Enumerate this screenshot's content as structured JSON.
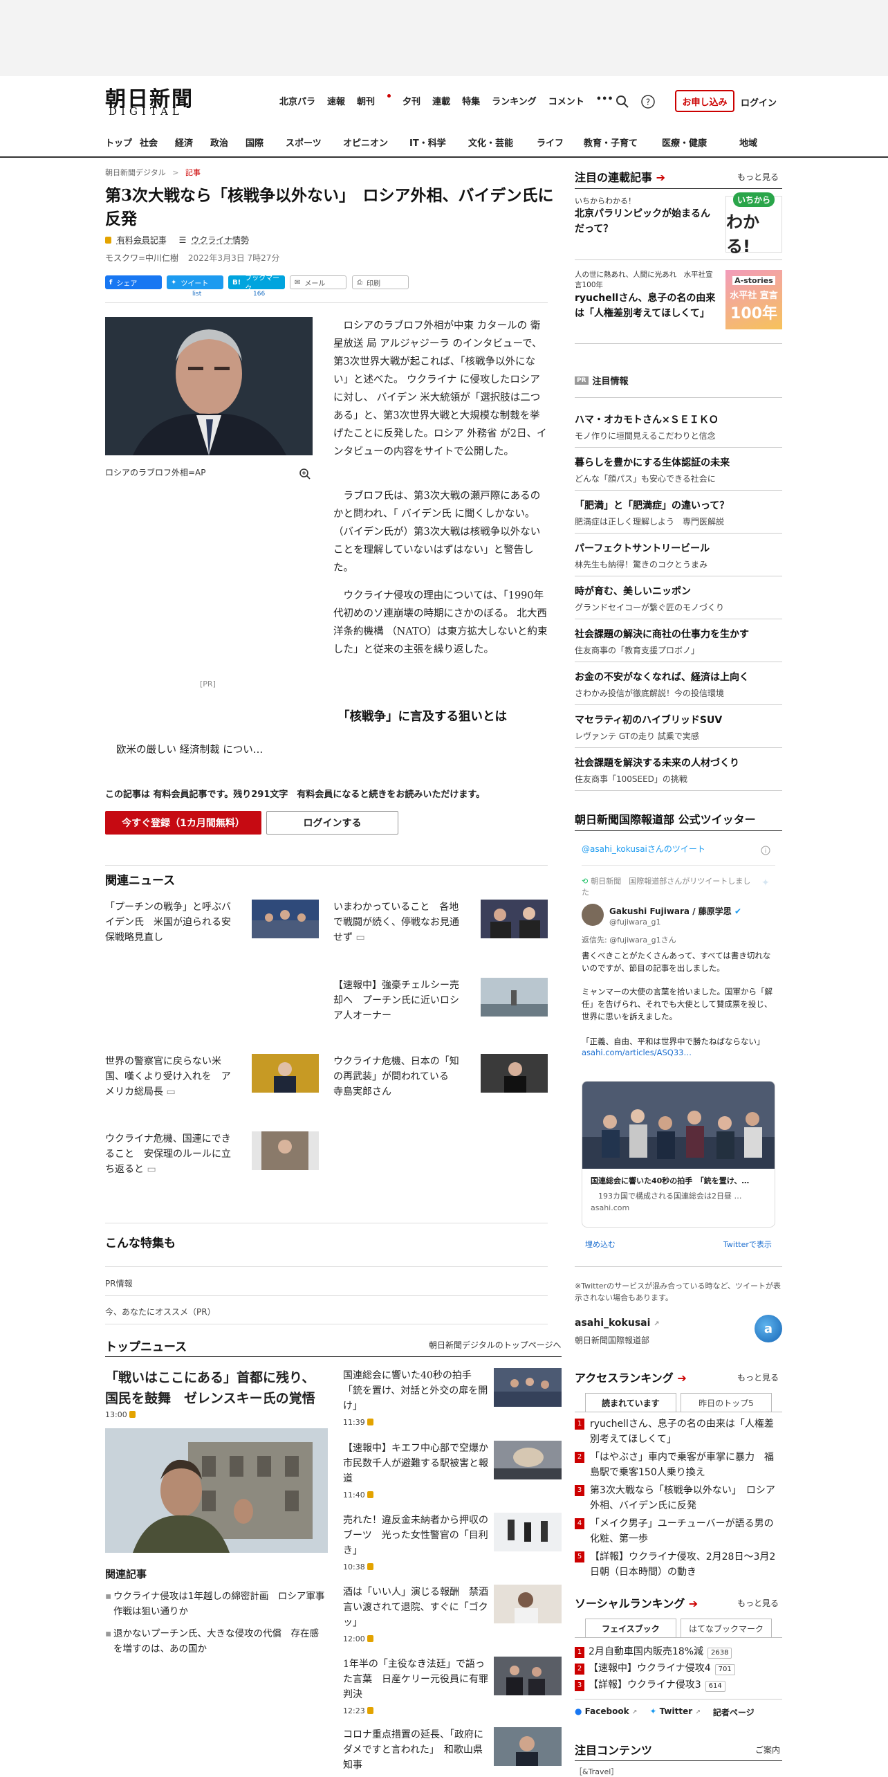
{
  "header": {
    "logo_text": "朝日新聞",
    "logo_sub": "DIGITAL",
    "top_nav": [
      "北京パラ",
      "速報",
      "朝刊",
      "夕刊",
      "連載",
      "特集",
      "ランキング",
      "コメント"
    ],
    "more": "•••",
    "subscribe": "お申し込み",
    "login": "ログイン"
  },
  "main_nav": [
    "トップ",
    "社会",
    "経済",
    "政治",
    "国際",
    "スポーツ",
    "オピニオン",
    "IT・科学",
    "文化・芸能",
    "ライフ",
    "教育・子育て",
    "医療・健康",
    "地域"
  ],
  "breadcrumb": {
    "home": "朝日新聞デジタル",
    "sep": ">",
    "current": "記事"
  },
  "article": {
    "title": "第3次大戦なら「核戦争以外ない」　ロシア外相、バイデン氏に反発",
    "member_tag": "有料会員記事",
    "topic": "ウクライナ情勢",
    "byline": "モスクワ=中川仁樹",
    "date": "2022年3月3日 7時27分",
    "share": {
      "facebook": "シェア",
      "twitter": "ツイート",
      "twitter_count": "list",
      "hatena": "ブックマーク",
      "hatena_count": "166",
      "mail": "メール",
      "print": "印刷"
    },
    "photo_caption": "ロシアのラブロフ外相=AP",
    "paragraphs": [
      "ロシアのラブロフ外相が中東 カタールの 衛星放送 局 アルジャジーラ のインタビューで、第3次世界大戦が起これば、「核戦争以外にない」と述べた。 ウクライナ に侵攻したロシアに対し、 バイデン 米大統領が「選択肢は二つある」と、第3次世界大戦と大規模な制裁を挙げたことに反発した。ロシア 外務省 が2日、インタビューの内容をサイトで公開した。",
      "ラブロフ氏は、第3次大戦の瀬戸際にあるのかと問われ、「 バイデン氏 に聞くしかない。（バイデン氏が）第3次大戦は核戦争以外ないことを理解していないはずはない」と警告した。",
      "ウクライナ侵攻の理由については、「1990年代初めのソ連崩壊の時期にさかのぼる。 北大西洋条約機構 （NATO）は東方拡大しないと約束した」と従来の主張を繰り返した。"
    ],
    "pr": "[PR]",
    "subhead": "「核戦争」に言及する狙いとは",
    "teaser": "欧米の厳しい 経済制裁 につい…",
    "paywall": "この記事は 有料会員記事です。残り291文字　有料会員になると続きをお読みいただけます。",
    "register_btn": "今すぐ登録（1カ月間無料）",
    "login_btn": "ログインする"
  },
  "related": {
    "heading": "関連ニュース",
    "items": [
      "「プーチンの戦争」と呼ぶバイデン氏　米国が迫られる安保戦略見直し",
      "いまわかっていること　各地で戦闘が続く、停戦なお見通せず",
      "【速報中】強豪チェルシー売却へ　プーチン氏に近いロシア人オーナー",
      "世界の警察官に戻らない米国、嘆くより受け入れを　アメリカ総局長",
      "ウクライナ危機、日本の「知の再武装」が問われている　寺島実郎さん",
      "ウクライナ危機、国連にできること　安保理のルールに立ち返ると"
    ]
  },
  "tokushu": {
    "heading": "こんな特集も",
    "pr_info": "PR情報",
    "recommend": "今、あなたにオススメ（PR）"
  },
  "top_news": {
    "heading": "トップニュース",
    "link": "朝日新聞デジタルのトップページへ",
    "lead_title": "「戦いはここにある」首都に残り、国民を鼓舞　ゼレンスキー氏の覚悟",
    "lead_time": "13:00",
    "related_heading": "関連記事",
    "related_items": [
      "ウクライナ侵攻は1年越しの綿密計画　ロシア軍事作戦は狙い通りか",
      "退かないプーチン氏、大きな侵攻の代償　存在感を増すのは、あの国か"
    ],
    "items": [
      {
        "title": "国連総会に響いた40秒の拍手「銃を置け、対話と外交の扉を開け」",
        "time": "11:39"
      },
      {
        "title": "【速報中】キエフ中心部で空爆か　市民数千人が避難する駅被害と報道",
        "time": "11:40"
      },
      {
        "title": "売れた！違反金未納者から押収のブーツ　光った女性警官の「目利き」",
        "time": "10:38"
      },
      {
        "title": "酒は「いい人」演じる報酬　禁酒言い渡されて退院、すぐに「ゴクッ」",
        "time": "12:00"
      },
      {
        "title": "1年半の「主役なき法廷」で語った言葉　日産ケリー元役員に有罪判決",
        "time": "12:23"
      },
      {
        "title": "コロナ重点措置の延長、「政府にダメですと言われた」　和歌山県知事",
        "time": ""
      }
    ]
  },
  "sidebar": {
    "serial_heading": "注目の連載記事",
    "more": "もっと見る",
    "serials": [
      {
        "label": "いちからわかる！",
        "title": "北京パラリンピックが始まるんだって？",
        "badge": "いちから わかる!"
      },
      {
        "label": "人の世に熱あれ、人間に光あれ　水平社宣言100年",
        "title": "ryuchellさん、息子の名の由来は「人権差別考えてほしくて」",
        "badge": "水平社 宣言 100年"
      }
    ],
    "attention_heading": "注目情報",
    "attention": [
      {
        "title": "ハマ・オカモトさん×ＳＥＩＫＯ",
        "sub": "モノ作りに垣間見えるこだわりと信念"
      },
      {
        "title": "暮らしを豊かにする生体認証の未来",
        "sub": "どんな「顔パス」も安心できる社会に"
      },
      {
        "title": "「肥満」と「肥満症」の違いって？",
        "sub": "肥満症は正しく理解しよう　専門医解説"
      },
      {
        "title": "パーフェクトサントリービール",
        "sub": "林先生も納得！驚きのコクとうまみ"
      },
      {
        "title": "時が育む、美しいニッポン",
        "sub": "グランドセイコーが繋ぐ匠のモノづくり"
      },
      {
        "title": "社会課題の解決に商社の仕事力を生かす",
        "sub": "住友商事の「教育支援プロボノ」"
      },
      {
        "title": "お金の不安がなくなれば、経済は上向く",
        "sub": "さわかみ投信が徹底解説！今の投信環境"
      },
      {
        "title": "マセラティ初のハイブリッドSUV",
        "sub": "レヴァンテ GTの走り 試乗で実感"
      },
      {
        "title": "社会課題を解決する未来の人材づくり",
        "sub": "住友商事「100SEED」の挑戦"
      }
    ],
    "twitter_heading": "朝日新聞国際報道部 公式ツイッター",
    "twitter": {
      "handle_line": "@asahi_kokusaiさんのツイート",
      "rt_line": "朝日新聞　国際報道部さんがリツイートしました",
      "user_name": "Gakushi Fujiwara / 藤原学思",
      "user_handle": "@fujiwara_g1",
      "reply_to": "返信先: @fujiwara_g1さん",
      "text1": "書くべきことがたくさんあって、すべては書き切れないのですが、節目の記事を出しました。",
      "text2": "ミャンマーの大使の言葉を拾いました。国軍から「解任」を告げられ、それでも大使として賛成票を投じ、世界に思いを訴えました。",
      "text3": "「正義、自由、平和は世界中で勝たねばならない」",
      "link": "asahi.com/articles/ASQ33…",
      "card_title": "国連総会に響いた40秒の拍手　「銃を置け、…",
      "card_desc": "　193カ国で構成される国連総会は2日昼 …",
      "card_domain": "asahi.com",
      "embed": "埋め込む",
      "view": "Twitterで表示",
      "notice": "※Twitterのサービスが混み合っている時など、ツイートが表示されない場合もあります。",
      "account": "asahi_kokusai",
      "account_name": "朝日新聞国際報道部"
    },
    "access_heading": "アクセスランキング",
    "access_tabs": [
      "読まれています",
      "昨日のトップ5"
    ],
    "access_items": [
      "ryuchellさん、息子の名の由来は「人権差別考えてほしくて」",
      "「はやぶさ」車内で乗客が車掌に暴力　福島駅で乗客150人乗り換え",
      "第3次大戦なら「核戦争以外ない」　ロシア外相、バイデン氏に反発",
      "「メイク男子」ユーチューバーが語る男の化粧、第一歩",
      "【詳報】ウクライナ侵攻、2月28日～3月2日朝（日本時間）の動き"
    ],
    "social_heading": "ソーシャルランキング",
    "social_tabs": [
      "フェイスブック",
      "はてなブックマーク"
    ],
    "social_items": [
      {
        "title": "2月自動車国内販売18%減",
        "count": "2638"
      },
      {
        "title": "【速報中】ウクライナ侵攻4",
        "count": "701"
      },
      {
        "title": "【詳報】ウクライナ侵攻3",
        "count": "614"
      }
    ],
    "social_links": [
      "Facebook",
      "Twitter",
      "記者ページ"
    ],
    "featured_heading": "注目コンテンツ",
    "featured_link": "ご案内",
    "featured_first": "［&Travel］"
  }
}
